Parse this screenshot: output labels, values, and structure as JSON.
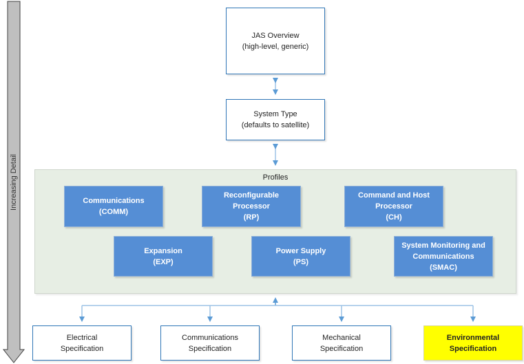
{
  "side_label": "Increasing Detail",
  "top_boxes": {
    "overview": "JAS Overview\n(high-level, generic)",
    "system_type": "System Type\n(defaults to satellite)"
  },
  "profiles": {
    "title": "Profiles",
    "items": [
      {
        "label": "Communications\n(COMM)"
      },
      {
        "label": "Reconfigurable\nProcessor\n(RP)"
      },
      {
        "label": "Command and Host\nProcessor\n(CH)"
      },
      {
        "label": "Expansion\n(EXP)"
      },
      {
        "label": "Power Supply\n(PS)"
      },
      {
        "label": "System Monitoring and\nCommunications\n(SMAC)"
      }
    ]
  },
  "specifications": [
    {
      "label": "Electrical\nSpecification",
      "highlighted": false
    },
    {
      "label": "Communications\nSpecification",
      "highlighted": false
    },
    {
      "label": "Mechanical\nSpecification",
      "highlighted": false
    },
    {
      "label": "Environmental\nSpecification",
      "highlighted": true
    }
  ],
  "colors": {
    "profile_box": "#558ed5",
    "connector": "#5b9bd5",
    "highlight": "#ffff00",
    "profiles_bg": "#e7eee4"
  }
}
